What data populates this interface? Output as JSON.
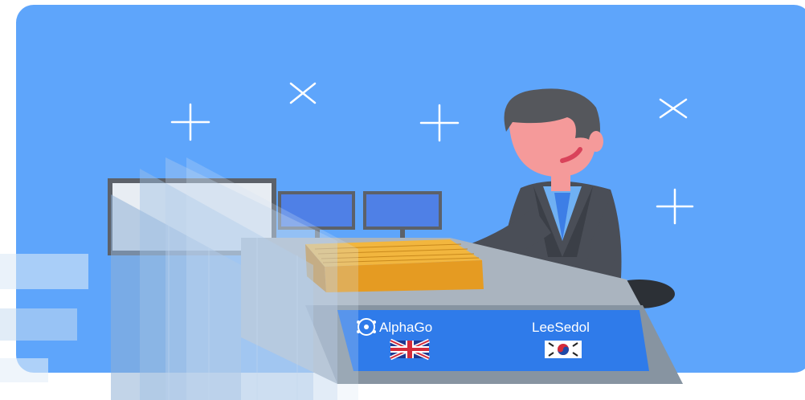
{
  "colors": {
    "sky": "#5ea5fb",
    "desk_top": "#aab4bf",
    "desk_front": "#8794a1",
    "banner": "#2f7bea",
    "suit": "#4a4e57",
    "skin": "#f59a9a",
    "hair": "#55575c",
    "board": "#e59b22",
    "monitor_screen": "#4f80e6"
  },
  "players": {
    "left": {
      "name": "AlphaGo",
      "flag": "uk-flag-icon",
      "logo": "alphago-logo-icon"
    },
    "right": {
      "name": "LeeSedol",
      "flag": "korea-flag-icon"
    }
  },
  "decorations": [
    "plus-icon",
    "cross-icon"
  ]
}
